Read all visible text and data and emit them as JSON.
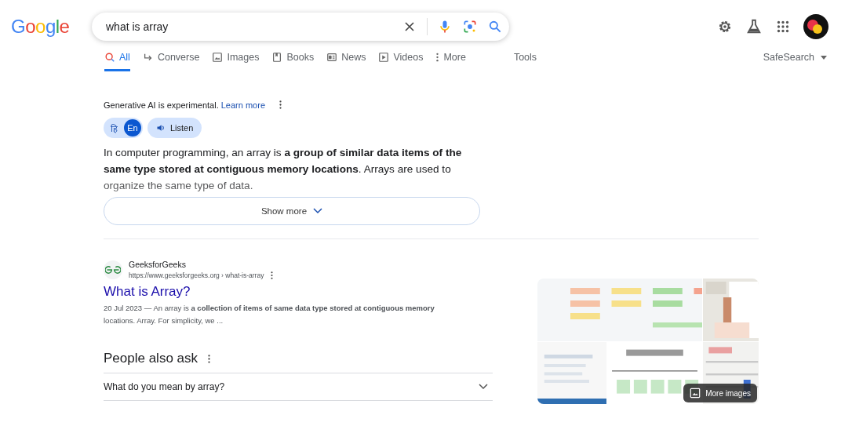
{
  "logo": "Google",
  "search": {
    "value": "what is array"
  },
  "tabs": [
    {
      "label": "All",
      "selected": true
    },
    {
      "label": "Converse",
      "selected": false
    },
    {
      "label": "Images",
      "selected": false
    },
    {
      "label": "Books",
      "selected": false
    },
    {
      "label": "News",
      "selected": false
    },
    {
      "label": "Videos",
      "selected": false
    },
    {
      "label": "More",
      "selected": false
    }
  ],
  "tools": "Tools",
  "safesearch": "SafeSearch",
  "ai_overview": {
    "notice": "Generative AI is experimental.",
    "learn_more": "Learn more",
    "languages": [
      {
        "label": "हि",
        "selected": false
      },
      {
        "label": "En",
        "selected": true
      }
    ],
    "listen": "Listen",
    "answer": "In computer programming, an array is **a group of similar data items of the same type stored at contiguous memory locations**. Arrays are used to organize the same type of data.",
    "show_more": "Show more"
  },
  "result": {
    "site": "GeeksforGeeks",
    "url": "https://www.geeksforgeeks.org › what-is-array",
    "title": "What is Array?",
    "snippet": "20 Jul 2023 — An array is **a collection of items of same data type stored at contiguous memory** locations. Array. For simplicity, we ..."
  },
  "people_also_ask": {
    "heading": "People also ask",
    "questions": [
      {
        "text": "What do you mean by array?",
        "expanded": false
      }
    ]
  },
  "images": {
    "more": "More images"
  }
}
